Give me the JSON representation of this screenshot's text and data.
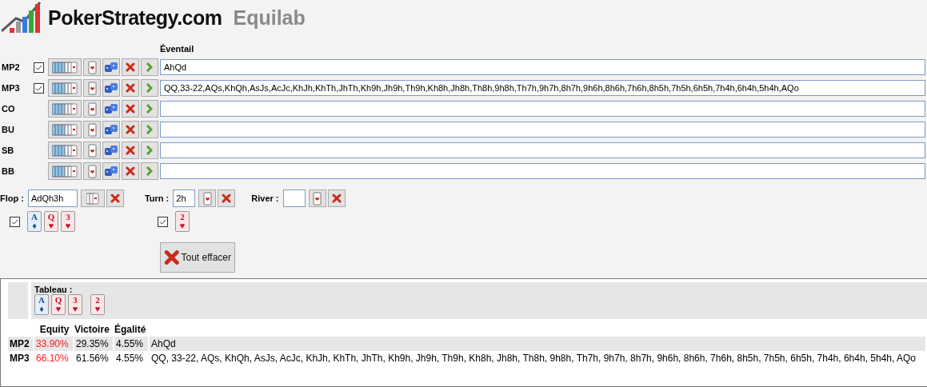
{
  "header": {
    "brand": "PokerStrategy.com",
    "product": "Equilab"
  },
  "range_heading": "Éventail",
  "players": [
    {
      "name": "MP2",
      "kind": "with_checkbox",
      "checked": true,
      "range": "AhQd"
    },
    {
      "name": "MP3",
      "kind": "with_checkbox",
      "checked": true,
      "range": "QQ,33-22,AQs,KhQh,AsJs,AcJc,KhJh,KhTh,JhTh,Kh9h,Jh9h,Th9h,Kh8h,Jh8h,Th8h,9h8h,Th7h,9h7h,8h7h,9h6h,8h6h,7h6h,8h5h,7h5h,6h5h,7h4h,6h4h,5h4h,AQo"
    },
    {
      "name": "CO",
      "kind": "plain"
    },
    {
      "name": "BU",
      "kind": "plain"
    },
    {
      "name": "SB",
      "kind": "plain"
    },
    {
      "name": "BB",
      "kind": "plain"
    }
  ],
  "board": [
    {
      "kind": "flop",
      "label": "Flop :",
      "value": "AdQh3h",
      "checked": true,
      "cards": [
        {
          "rank": "A",
          "suit": "♦",
          "color": "#1c4f96"
        },
        {
          "rank": "Q",
          "suit": "♥",
          "color": "#c8102e"
        },
        {
          "rank": "3",
          "suit": "♥",
          "color": "#c8102e"
        }
      ]
    },
    {
      "kind": "turn",
      "label": "Turn :",
      "value": "2h",
      "checked": true,
      "cards": [
        {
          "rank": "2",
          "suit": "♥",
          "color": "#c8102e"
        }
      ]
    },
    {
      "kind": "river",
      "label": "River :"
    }
  ],
  "clear_button": "Tout effacer",
  "results": {
    "board_label": "Tableau :",
    "board_groups": [
      [
        {
          "rank": "A",
          "suit": "♦",
          "color": "#1c4f96"
        },
        {
          "rank": "Q",
          "suit": "♥",
          "color": "#c8102e"
        },
        {
          "rank": "3",
          "suit": "♥",
          "color": "#c8102e"
        }
      ],
      [
        {
          "rank": "2",
          "suit": "♥",
          "color": "#c8102e"
        }
      ]
    ],
    "columns": [
      "Equity",
      "Victoire",
      "Égalité"
    ],
    "rows": [
      {
        "player": "MP2",
        "selected": true,
        "equity": "33.90%",
        "win": "29.35%",
        "tie": "4.55%",
        "hand": "AhQd"
      },
      {
        "player": "MP3",
        "selected": false,
        "equity": "66.10%",
        "win": "61.56%",
        "tie": "4.55%",
        "hand": "QQ, 33-22, AQs, KhQh, AsJs, AcJc, KhJh, KhTh, JhTh, Kh9h, Jh9h, Th9h, Kh8h, Jh8h, Th8h, 9h8h, Th7h, 9h7h, 8h7h, 9h6h, 8h6h, 7h6h, 8h5h, 7h5h, 6h5h, 7h4h, 6h4h, 5h4h, AQo"
      }
    ]
  }
}
